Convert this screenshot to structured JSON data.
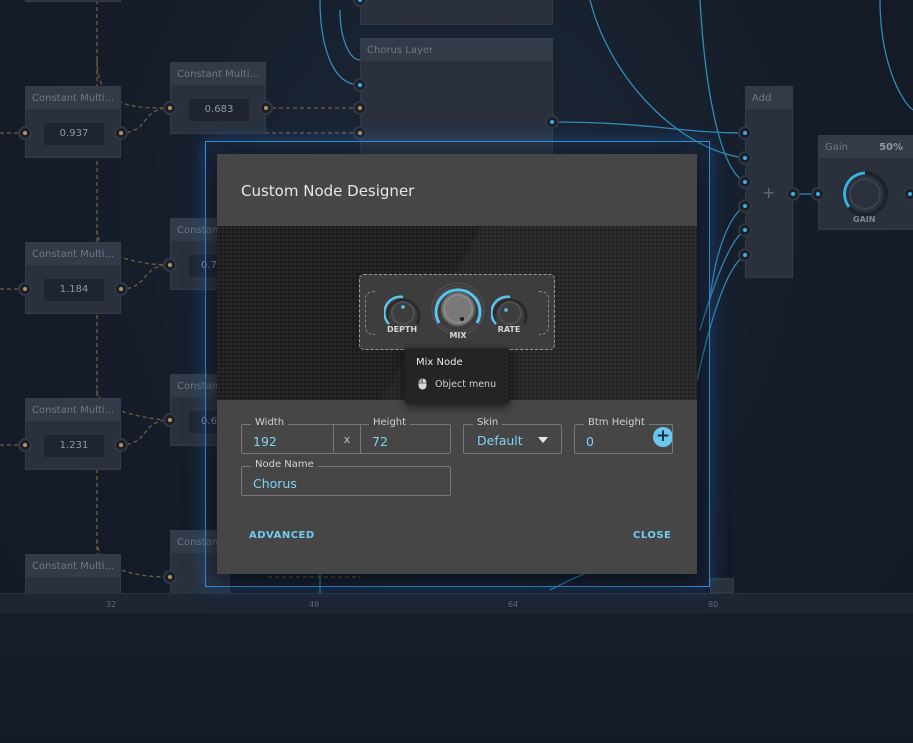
{
  "graph": {
    "nodes": [
      {
        "title": "Constant Multi...",
        "value": "0.937"
      },
      {
        "title": "Constant Multi...",
        "value": "0.683"
      },
      {
        "title": "Constant Multi...",
        "value": "1.184"
      },
      {
        "title": "Constant Multi...",
        "value": "1.231"
      },
      {
        "title": "Constant Multi...",
        "value": ""
      },
      {
        "title": "Constan",
        "value": "0.7"
      },
      {
        "title": "Constan",
        "value": "0.6"
      },
      {
        "title": "Constan",
        "value": ""
      }
    ],
    "chorus_layer_title": "Chorus Layer",
    "add_title": "Add",
    "add_symbol": "+",
    "gain": {
      "title": "Gain",
      "percent": "50%",
      "knob_label": "GAIN"
    }
  },
  "timeline": {
    "ticks": [
      "32",
      "48",
      "64",
      "80"
    ]
  },
  "dialog": {
    "title": "Custom Node Designer",
    "preview": {
      "knobs": {
        "depth": "DEPTH",
        "mix": "MIX",
        "rate": "RATE"
      },
      "tooltip": {
        "title": "Mix Node",
        "item": "Object menu"
      },
      "add_symbol": "+"
    },
    "fields": {
      "width": {
        "label": "Width",
        "value": "192"
      },
      "separator": "x",
      "height": {
        "label": "Height",
        "value": "72"
      },
      "skin": {
        "label": "Skin",
        "value": "Default"
      },
      "btm_height": {
        "label": "Btm Height",
        "value": "0"
      },
      "node_name": {
        "label": "Node Name",
        "value": "Chorus"
      }
    },
    "buttons": {
      "advanced": "ADVANCED",
      "close": "CLOSE"
    }
  },
  "colors": {
    "accent": "#72cbef",
    "wire_blue": "#3ab0e0",
    "wire_gold": "#b5935a",
    "dialog_bg": "#464646"
  }
}
